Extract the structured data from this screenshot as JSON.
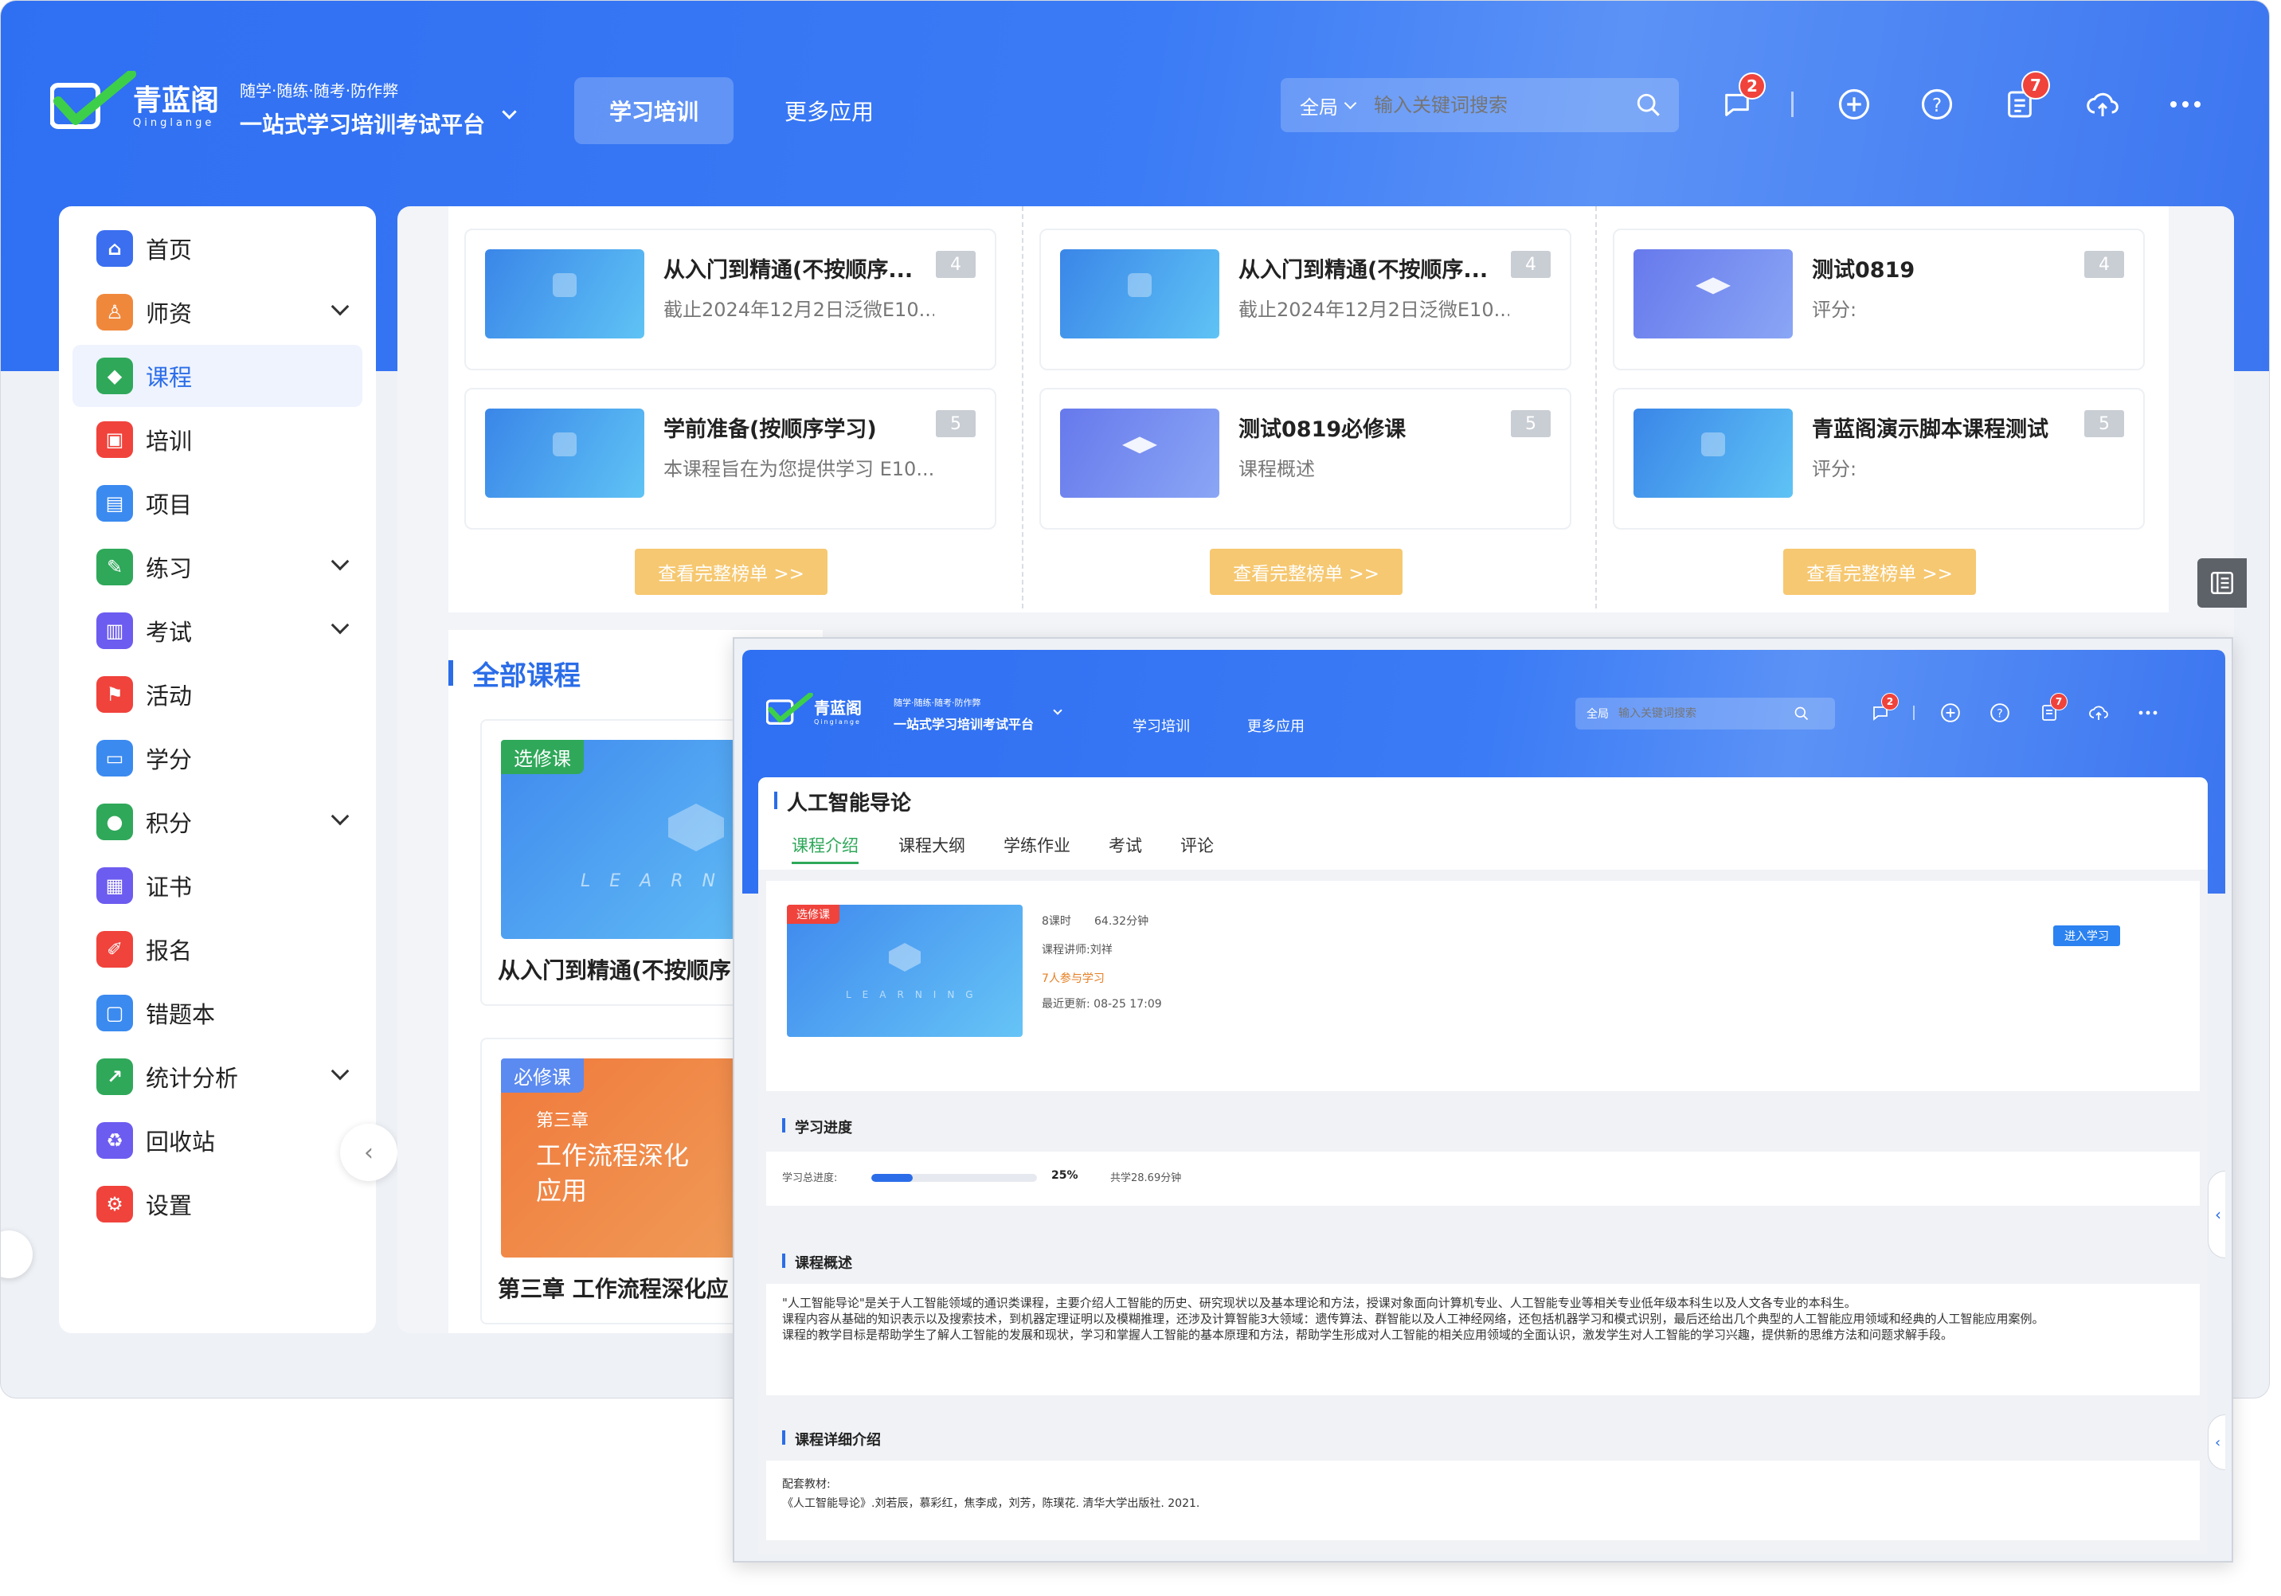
{
  "header": {
    "brand": "青蓝阁",
    "brand_sub": "Qinglange",
    "slogan_small": "随学·随练·随考·防作弊",
    "slogan_big": "一站式学习培训考试平台",
    "nav": [
      "学习培训",
      "更多应用"
    ],
    "search_scope": "全局",
    "search_placeholder": "输入关键词搜索",
    "msg_badge": "2",
    "task_badge": "7"
  },
  "sidebar": {
    "items": [
      {
        "label": "首页",
        "icon": "home-icon",
        "color": "#3b6ff0"
      },
      {
        "label": "师资",
        "icon": "teacher-icon",
        "color": "#f0883c"
      },
      {
        "label": "课程",
        "icon": "course-icon",
        "color": "#2fa85a"
      },
      {
        "label": "培训",
        "icon": "training-icon",
        "color": "#f0433c"
      },
      {
        "label": "项目",
        "icon": "project-icon",
        "color": "#3b8af0"
      },
      {
        "label": "练习",
        "icon": "practice-icon",
        "color": "#2fa85a"
      },
      {
        "label": "考试",
        "icon": "exam-icon",
        "color": "#6d5cf0"
      },
      {
        "label": "活动",
        "icon": "activity-icon",
        "color": "#f0433c"
      },
      {
        "label": "学分",
        "icon": "credit-icon",
        "color": "#3b8af0"
      },
      {
        "label": "积分",
        "icon": "points-icon",
        "color": "#2fa85a"
      },
      {
        "label": "证书",
        "icon": "certificate-icon",
        "color": "#6d5cf0"
      },
      {
        "label": "报名",
        "icon": "signup-icon",
        "color": "#f0433c"
      },
      {
        "label": "错题本",
        "icon": "mistakes-icon",
        "color": "#3b8af0"
      },
      {
        "label": "统计分析",
        "icon": "stats-icon",
        "color": "#2fa85a"
      },
      {
        "label": "回收站",
        "icon": "recycle-icon",
        "color": "#6d5cf0"
      },
      {
        "label": "设置",
        "icon": "settings-icon",
        "color": "#f0433c"
      }
    ],
    "active": "课程"
  },
  "ranking": {
    "columns": [
      {
        "cards": [
          {
            "title": "从入门到精通(不按顺序...",
            "sub": "截止2024年12月2日泛微E10...",
            "rank": "4",
            "style": "blue"
          },
          {
            "title": "学前准备(按顺序学习)",
            "sub": "本课程旨在为您提供学习 E10...",
            "rank": "5",
            "style": "blue"
          }
        ],
        "button": "查看完整榜单 >>"
      },
      {
        "cards": [
          {
            "title": "从入门到精通(不按顺序...",
            "sub": "截止2024年12月2日泛微E10...",
            "rank": "4",
            "style": "blue"
          },
          {
            "title": "测试0819必修课",
            "sub": "课程概述",
            "rank": "5",
            "style": "purple"
          }
        ],
        "button": "查看完整榜单 >>"
      },
      {
        "cards": [
          {
            "title": "测试0819",
            "sub": "评分:",
            "rank": "4",
            "style": "purple"
          },
          {
            "title": "青蓝阁演示脚本课程测试",
            "sub": "评分:",
            "rank": "5",
            "style": "blue"
          }
        ],
        "button": "查看完整榜单 >>"
      }
    ]
  },
  "all_courses": {
    "title": "全部课程",
    "cards": [
      {
        "tag": "选修课",
        "tag_color": "#2fa85a",
        "caption": "从入门到精通(不按顺序",
        "img_text": "LEARNI"
      },
      {
        "tag": "必修课",
        "tag_color": "#5b8af0",
        "caption": "第三章 工作流程深化应",
        "chapter": "第三章",
        "img_title": "工作流程深化应用"
      }
    ]
  },
  "detail": {
    "title": "人工智能导论",
    "tabs": [
      "课程介绍",
      "课程大纲",
      "学练作业",
      "考试",
      "评论"
    ],
    "active_tab": "课程介绍",
    "tag": "选修课",
    "thumb_text": "LEARNING",
    "hours": "8课时",
    "minutes": "64.32分钟",
    "teacher": "课程讲师:刘祥",
    "learners": "7人参与学习",
    "updated": "最近更新: 08-25 17:09",
    "enter_button": "进入学习",
    "progress_section": "学习进度",
    "progress_label": "学习总进度:",
    "progress_value": 0.25,
    "progress_text": "25%",
    "studied": "共学28.69分钟",
    "overview_section": "课程概述",
    "overview_lines": [
      "\"人工智能导论\"是关于人工智能领域的通识类课程，主要介绍人工智能的历史、研究现状以及基本理论和方法，授课对象面向计算机专业、人工智能专业等相关专业低年级本科生以及人文各专业的本科生。",
      "课程内容从基础的知识表示以及搜索技术，到机器定理证明以及模糊推理，还涉及计算智能3大领域：遗传算法、群智能以及人工神经网络，还包括机器学习和模式识别，最后还给出几个典型的人工智能应用领域和经典的人工智能应用案例。",
      "课程的教学目标是帮助学生了解人工智能的发展和现状，学习和掌握人工智能的基本原理和方法，帮助学生形成对人工智能的相关应用领域的全面认识，激发学生对人工智能的学习兴趣，提供新的思维方法和问题求解手段。"
    ],
    "detail_section": "课程详细介绍",
    "material_label": "配套教材:",
    "material": "《人工智能导论》.刘若辰，慕彩红，焦李成，刘芳，陈璞花. 清华大学出版社. 2021."
  }
}
